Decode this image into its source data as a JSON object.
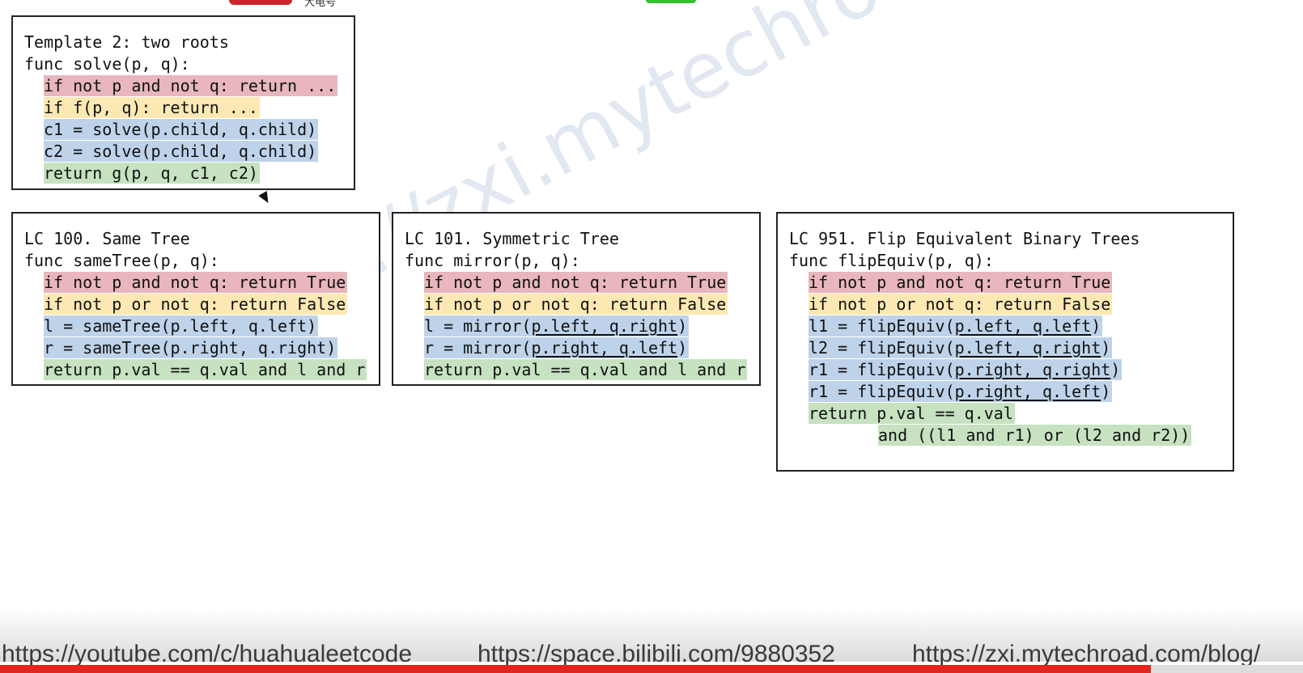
{
  "top": {
    "label": "大电号"
  },
  "watermark": "https://zxi.mytechroad.com/blog/",
  "template": {
    "title": "Template 2: two roots",
    "func": "func solve(p, q):",
    "lines": [
      "if not p and not q: return ...",
      "if f(p, q): return ...",
      "c1 = solve(p.child, q.child)",
      "c2 = solve(p.child, q.child)",
      "return g(p, q, c1, c2)"
    ]
  },
  "lc100": {
    "title": "LC 100. Same Tree",
    "func": "func sameTree(p, q):",
    "l1": "if not p and not q: return True",
    "l2": "if not p or not q: return False",
    "l3": "l = sameTree(p.left, q.left)",
    "l4": "r = sameTree(p.right, q.right)",
    "l5": "return p.val == q.val and l and r"
  },
  "lc101": {
    "title": "LC 101. Symmetric Tree",
    "func": "func mirror(p, q):",
    "l1": "if not p and not q: return True",
    "l2": "if not p or not q: return False",
    "l3a": "l = mirror(",
    "l3b": "p.left, q.right",
    "l3c": ")",
    "l4a": "r = mirror(",
    "l4b": "p.right, q.left",
    "l4c": ")",
    "l5": "return p.val == q.val and l and r"
  },
  "lc951": {
    "title": "LC 951. Flip Equivalent Binary Trees",
    "func": "func flipEquiv(p, q):",
    "l1": "if not p and not q: return True",
    "l2": "if not p or not q: return False",
    "l3a": "l1 = flipEquiv(",
    "l3b": "p.left, q.left",
    "l3c": ")",
    "l4a": "l2 = flipEquiv(",
    "l4b": "p.left, q.right",
    "l4c": ")",
    "l5a": "r1 = flipEquiv(",
    "l5b": "p.right, q.right",
    "l5c": ")",
    "l6a": "r1 = flipEquiv(",
    "l6b": "p.right, q.left",
    "l6c": ")",
    "l7": "return p.val == q.val",
    "l8": "and ((l1 and r1) or (l2 and r2))"
  },
  "footer": {
    "youtube": "https://youtube.com/c/huahualeetcode",
    "bilibili": "https://space.bilibili.com/9880352",
    "blog": "https://zxi.mytechroad.com/blog/"
  },
  "progress": {
    "fraction": 0.883
  },
  "colors": {
    "red": "#e8b6bc",
    "yellow": "#fbe8b3",
    "blue": "#bed3ea",
    "green": "#c6e2c1",
    "progress": "#e3251e"
  }
}
